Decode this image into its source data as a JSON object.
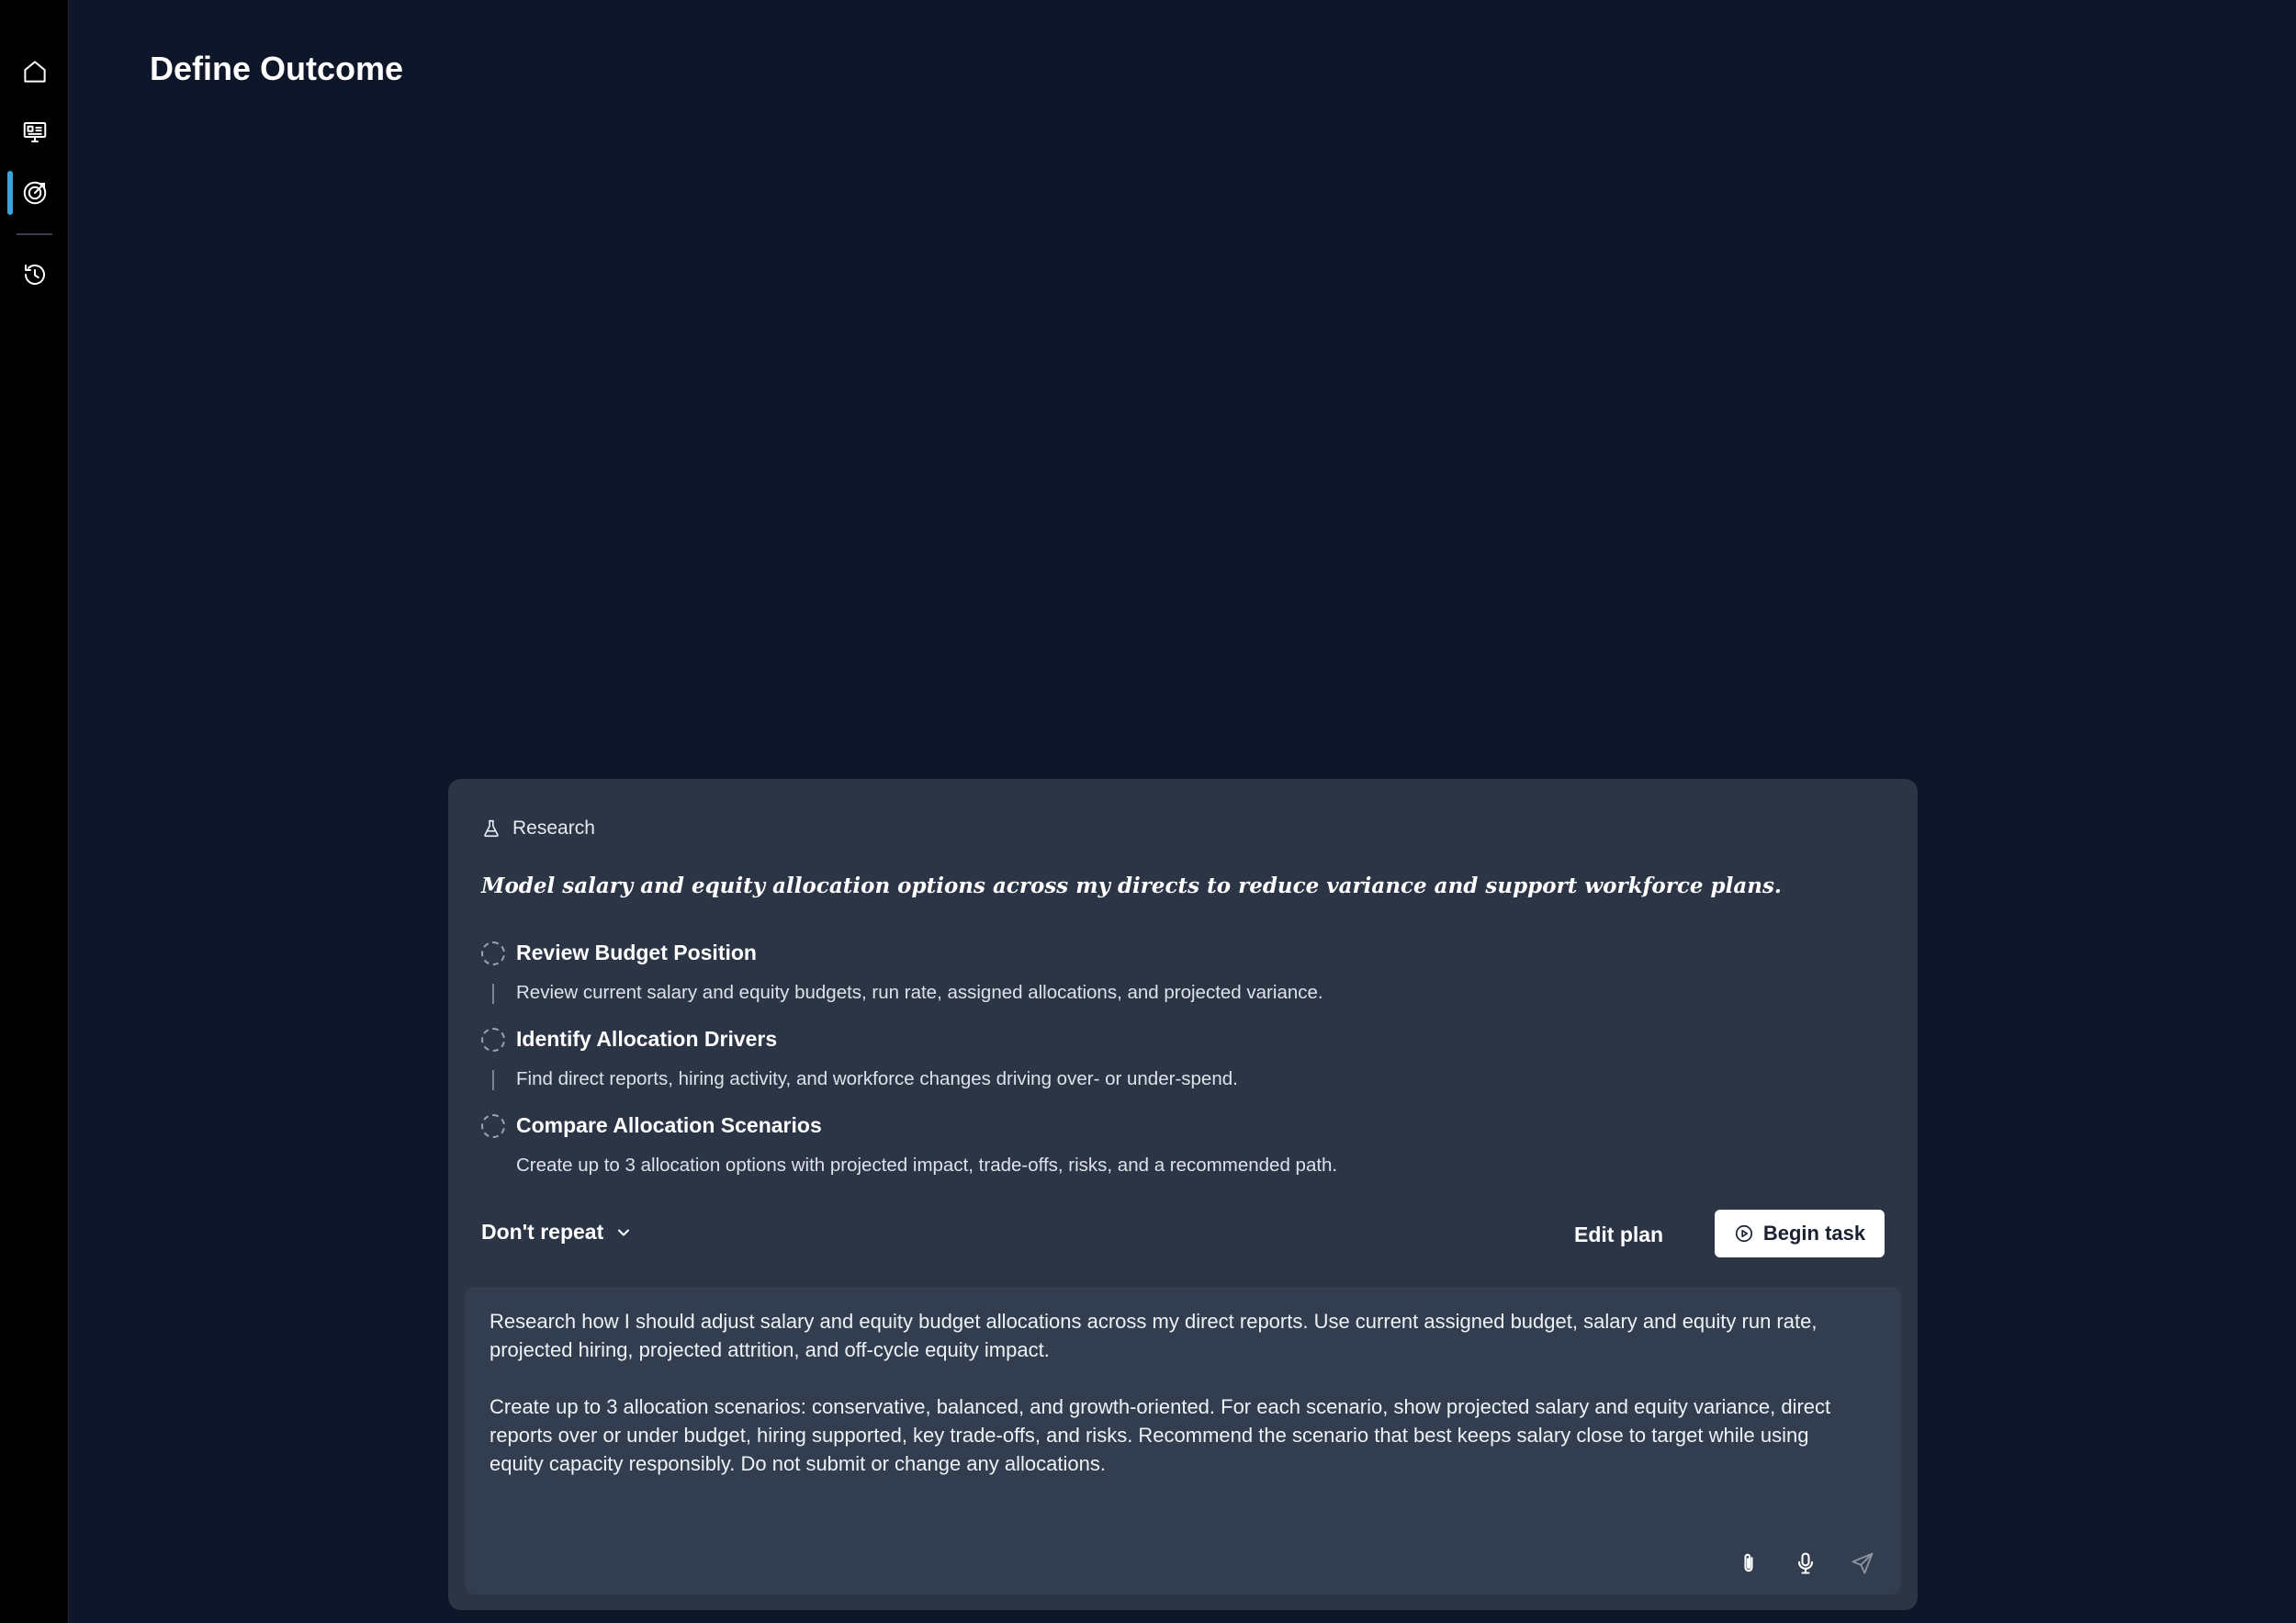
{
  "page": {
    "title": "Define Outcome"
  },
  "sidebar": {
    "items": [
      {
        "name": "home",
        "icon": "home-icon"
      },
      {
        "name": "dashboard",
        "icon": "presentation-icon"
      },
      {
        "name": "outcomes",
        "icon": "target-icon",
        "active": true
      },
      {
        "name": "history",
        "icon": "history-icon"
      }
    ],
    "active_color": "#3aa3dc"
  },
  "plan": {
    "mode_label": "Research",
    "mode_icon": "flask-icon",
    "goal": "Model salary and equity allocation options across my directs to reduce variance and support workforce plans.",
    "steps": [
      {
        "title": "Review Budget Position",
        "description": "Review current salary and equity budgets, run rate, assigned allocations, and projected variance."
      },
      {
        "title": "Identify Allocation Drivers",
        "description": "Find direct reports, hiring activity, and workforce changes driving over- or under-spend."
      },
      {
        "title": "Compare Allocation Scenarios",
        "description": "Create up to 3 allocation options with projected impact, trade-offs, risks, and a recommended path."
      }
    ],
    "repeat_label": "Don't repeat",
    "edit_label": "Edit plan",
    "begin_label": "Begin task"
  },
  "composer": {
    "paragraphs": [
      "Research how I should adjust salary and equity budget allocations across my direct reports. Use current assigned budget, salary and equity run rate, projected hiring, projected attrition, and off-cycle equity impact.",
      "Create up to 3 allocation scenarios: conservative, balanced, and growth-oriented. For each scenario, show projected salary and equity variance, direct reports over or under budget, hiring supported, key trade-offs, and risks. Recommend the scenario that best keeps salary close to target while using equity capacity responsibly. Do not submit or change any allocations."
    ],
    "icons": [
      "paperclip-icon",
      "microphone-icon",
      "send-icon"
    ]
  }
}
